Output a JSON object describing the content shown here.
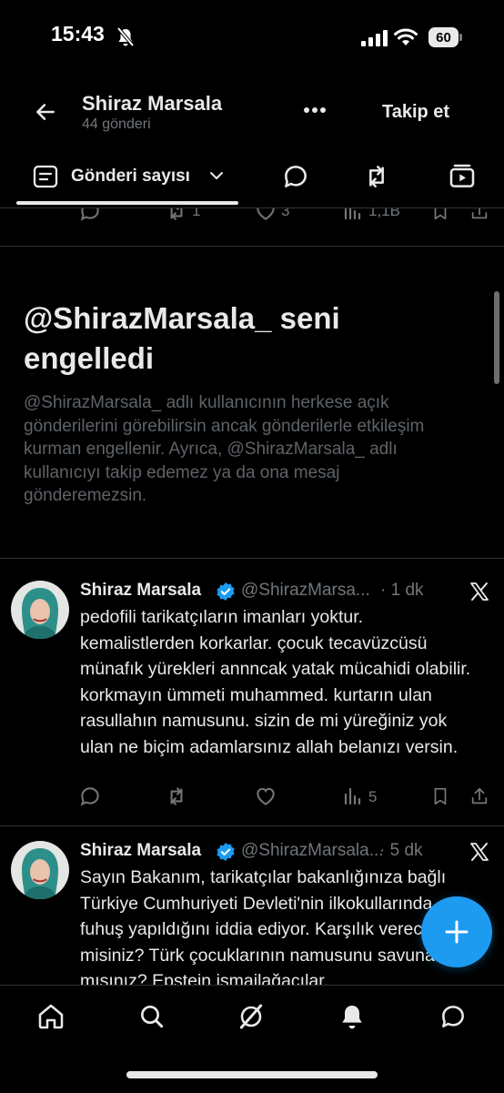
{
  "status_bar": {
    "time": "15:43",
    "battery": "60"
  },
  "header": {
    "name": "Shiraz Marsala",
    "post_count": "44 gönderi",
    "follow_label": "Takip et"
  },
  "tabs": {
    "active_label": "Gönderi sayısı"
  },
  "previous_tweet_actions": {
    "retweets": "1",
    "likes": "3",
    "views": "1,1B"
  },
  "blocked": {
    "title": "@ShirazMarsala_ seni engelledi",
    "description": "@ShirazMarsala_ adlı kullanıcının herkese açık gönderilerini görebilirsin ancak gönderilerle etkileşim kurman engellenir. Ayrıca, @ShirazMarsala_ adlı kullanıcıyı takip edemez ya da ona mesaj gönderemezsin."
  },
  "tweets": [
    {
      "name": "Shiraz Marsala",
      "handle": "@ShirazMarsa...",
      "time": "· 1 dk",
      "text": "pedofili tarikatçıların imanları yoktur. kemalistlerden korkarlar. çocuk tecavüzcüsü münafık yürekleri annncak yatak mücahidi olabilir. korkmayın ümmeti muhammed. kurtarın ulan rasullahın namusunu. sizin de mi yüreğiniz yok ulan ne biçim adamlarsınız allah belanızı versin.",
      "views": "5"
    },
    {
      "name": "Shiraz Marsala",
      "handle": "@ShirazMarsala...",
      "time": "· 5 dk",
      "text": "Sayın Bakanım, tarikatçılar bakanlığınıza bağlı Türkiye Cumhuriyeti Devleti'nin ilkokullarında fuhuş yapıldığını iddia ediyor. Karşılık verecek misiniz? Türk çocuklarının namusunu savunacak mısınız? Epstein ismailağacılar,"
    }
  ],
  "colors": {
    "accent": "#1d9bf0",
    "text": "#e7e9ea",
    "muted": "#71767b",
    "border": "#2f3336"
  }
}
